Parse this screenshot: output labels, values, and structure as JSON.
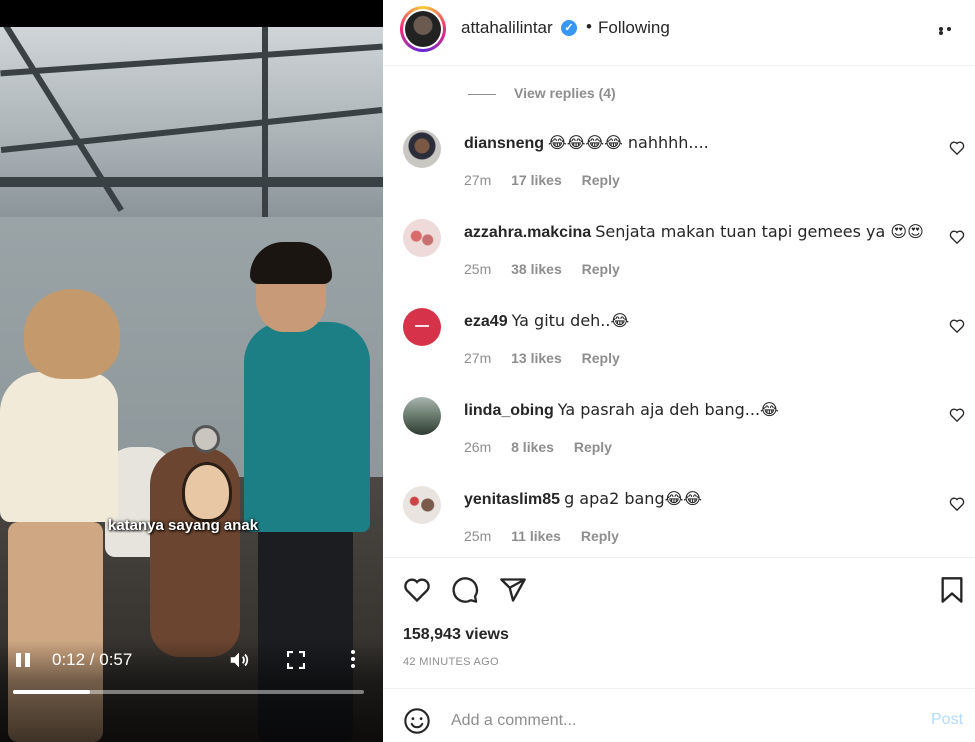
{
  "header": {
    "username": "attahalilintar",
    "verified_icon": "verified-badge-icon",
    "separator": "•",
    "follow_status": "Following",
    "more_icon": "more-horizontal-icon"
  },
  "video": {
    "caption": "katanya sayang anak",
    "time": "0:12 / 0:57",
    "progress_fraction": 0.22,
    "icons": [
      "pause-icon",
      "volume-icon",
      "fullscreen-icon",
      "more-vertical-icon"
    ]
  },
  "comments": {
    "view_replies": "View replies (4)",
    "items": [
      {
        "username": "diansneng",
        "text": "😂😂😂😂 nahhhh....",
        "time": "27m",
        "likes": "17 likes",
        "reply": "Reply"
      },
      {
        "username": "azzahra.makcina",
        "text": "Senjata makan tuan tapi gemees ya 😍😍",
        "time": "25m",
        "likes": "38 likes",
        "reply": "Reply"
      },
      {
        "username": "eza49",
        "text": "Ya gitu deh..😂",
        "time": "27m",
        "likes": "13 likes",
        "reply": "Reply"
      },
      {
        "username": "linda_obing",
        "text": "Ya pasrah aja deh bang...😂",
        "time": "26m",
        "likes": "8 likes",
        "reply": "Reply"
      },
      {
        "username": "yenitaslim85",
        "text": "g apa2 bang😂😂",
        "time": "25m",
        "likes": "11 likes",
        "reply": "Reply"
      }
    ]
  },
  "actions": {
    "views": "158,943 views",
    "posted_ago": "42 MINUTES AGO",
    "icons": [
      "heart-icon",
      "comment-icon",
      "share-icon",
      "bookmark-icon"
    ]
  },
  "add_comment": {
    "placeholder": "Add a comment...",
    "post_label": "Post"
  },
  "colors": {
    "link_blue": "#3897f0",
    "post_disabled": "#b3dbff",
    "muted_text": "#8e8e8e",
    "eza49_avatar": "#d6334a"
  }
}
